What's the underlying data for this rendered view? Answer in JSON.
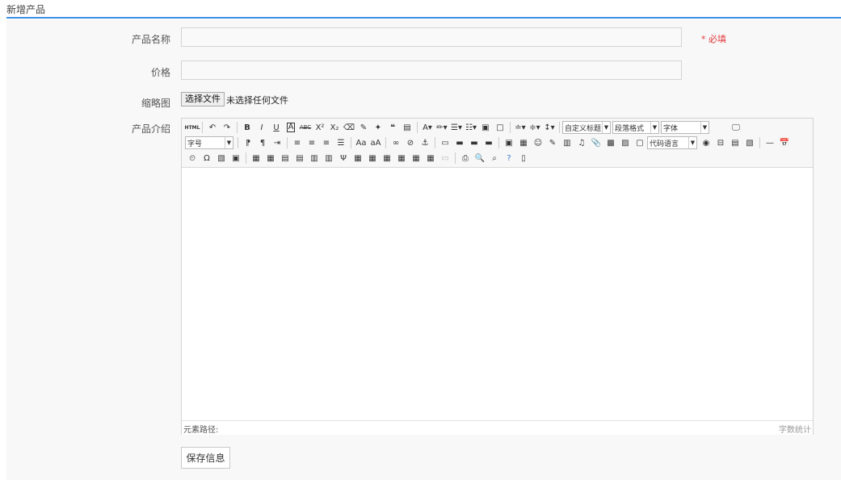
{
  "tab": {
    "title": "新增产品"
  },
  "form": {
    "name_label": "产品名称",
    "name_value": "",
    "required_note": "* 必填",
    "price_label": "价格",
    "price_value": "",
    "thumbnail_label": "缩略图",
    "file_button": "选择文件",
    "file_status": "未选择任何文件",
    "intro_label": "产品介绍",
    "save_button": "保存信息"
  },
  "editor": {
    "combo_custom_title": "自定义标题",
    "combo_paragraph": "段落格式",
    "combo_font": "字体",
    "combo_fontsize": "字号",
    "combo_code_lang": "代码语言",
    "html_icon_text": "HTML",
    "path_label": "元素路径:",
    "wordcount_label": "字数统计",
    "colors": {
      "accent": "#3a8ee6",
      "required": "#e4393c"
    }
  }
}
